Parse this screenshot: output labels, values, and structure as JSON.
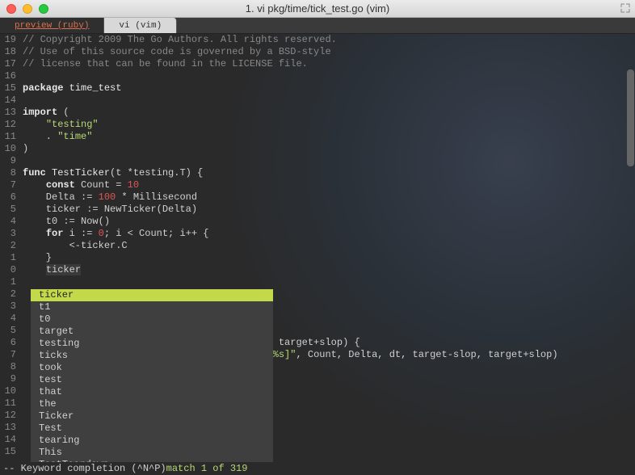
{
  "window": {
    "title": "1. vi pkg/time/tick_test.go (vim)"
  },
  "tabs": {
    "preview": "preview (ruby)",
    "active": "vi (vim)"
  },
  "lines": [
    {
      "n": "19",
      "t": "// Copyright 2009 The Go Authors. All rights reserved.",
      "cls": "c-comment"
    },
    {
      "n": "18",
      "t": "// Use of this source code is governed by a BSD-style",
      "cls": "c-comment"
    },
    {
      "n": "17",
      "t": "// license that can be found in the LICENSE file.",
      "cls": "c-comment"
    },
    {
      "n": "16",
      "t": "",
      "cls": "c-default"
    }
  ],
  "line15": {
    "n": "15",
    "kw": "package",
    "rest": " time_test"
  },
  "line14": {
    "n": "14"
  },
  "line13": {
    "n": "13",
    "kw": "import",
    "rest": " ("
  },
  "line12": {
    "n": "12",
    "indent": "    ",
    "str": "\"testing\""
  },
  "line11": {
    "n": "11",
    "indent": "    . ",
    "str": "\"time\""
  },
  "line10": {
    "n": "10",
    "t": ")"
  },
  "line9": {
    "n": "9"
  },
  "line8": {
    "n": "8",
    "kw": "func",
    "name": " TestTicker",
    "rest": "(t *testing.T) {"
  },
  "line7": {
    "n": "7",
    "indent": "    ",
    "kw": "const",
    "mid": " Count = ",
    "num": "10"
  },
  "line6": {
    "n": "6",
    "indent": "    ",
    "pre": "Delta := ",
    "num": "100",
    "post": " * Millisecond"
  },
  "line5": {
    "n": "5",
    "t": "    ticker := NewTicker(Delta)"
  },
  "line4": {
    "n": "4",
    "t": "    t0 := Now()"
  },
  "line3": {
    "n": "3",
    "indent": "    ",
    "kw": "for",
    "mid": " i := ",
    "num": "0",
    "post": "; i < Count; i++ {"
  },
  "line2": {
    "n": "2",
    "t": "        <-ticker.C"
  },
  "line1": {
    "n": "1",
    "t": "    }"
  },
  "cursor_line": {
    "n": "0",
    "indent": "    ",
    "word": "ticker"
  },
  "overflow": [
    {
      "n": "1"
    },
    {
      "n": "2"
    },
    {
      "n": "3"
    },
    {
      "n": "4"
    },
    {
      "n": "5"
    },
    {
      "n": "6",
      "t": "                                    && dt > target+slop) {"
    },
    {
      "n": "7",
      "pre": "                                   ",
      "str": "ted [%s,%s]\"",
      "post": ", Count, Delta, dt, target-slop, target+slop)"
    },
    {
      "n": "8"
    },
    {
      "n": "9"
    },
    {
      "n": "10"
    },
    {
      "n": "11"
    },
    {
      "n": "12"
    },
    {
      "n": "13"
    },
    {
      "n": "14"
    },
    {
      "n": "15"
    }
  ],
  "completions": [
    "ticker",
    "t1",
    "t0",
    "target",
    "testing",
    "ticks",
    "took",
    "test",
    "that",
    "the",
    "Ticker",
    "Test",
    "tearing",
    "This",
    "TestTeardown"
  ],
  "status": {
    "prefix": "-- Keyword completion (^N^P) ",
    "match": "match 1 of 319"
  }
}
